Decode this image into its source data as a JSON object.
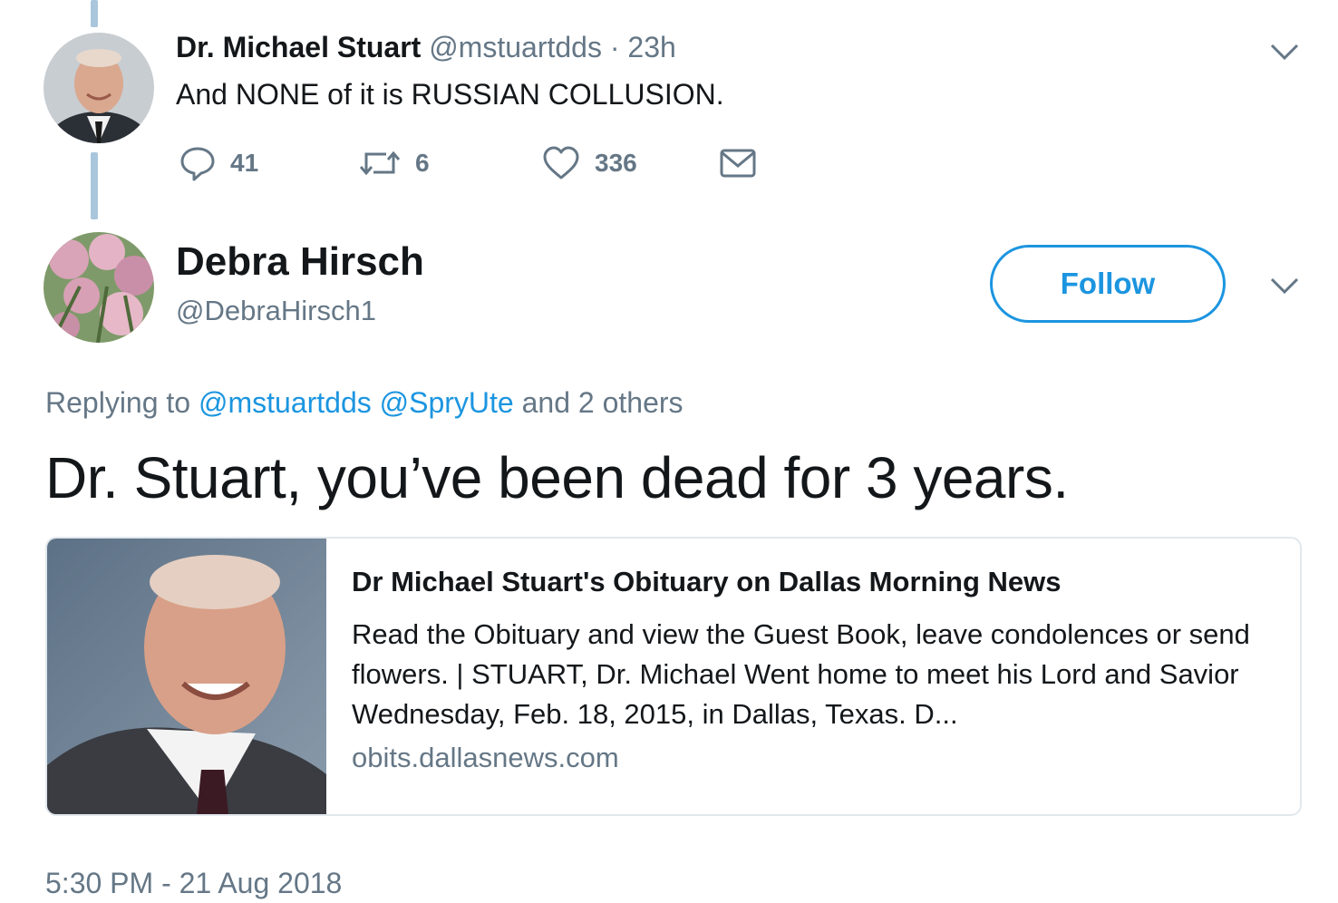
{
  "tweet1": {
    "display_name": "Dr. Michael Stuart",
    "handle": "@mstuartdds",
    "separator": "·",
    "time": "23h",
    "text": "And NONE of it is RUSSIAN COLLUSION.",
    "reply_count": "41",
    "retweet_count": "6",
    "like_count": "336"
  },
  "tweet2": {
    "display_name": "Debra Hirsch",
    "handle": "@DebraHirsch1",
    "follow_label": "Follow",
    "replying_prefix": "Replying to",
    "reply_mentions": [
      "@mstuartdds",
      "@SpryUte"
    ],
    "replying_suffix": "and 2 others",
    "text": "Dr. Stuart, you’ve been dead for 3 years.",
    "timestamp": "5:30 PM - 21 Aug 2018"
  },
  "card": {
    "title": "Dr Michael Stuart's Obituary on Dallas Morning News",
    "description": "Read the Obituary and view the Guest Book, leave condolences or send flowers. | STUART, Dr. Michael Went home to meet his Lord and Savior Wednesday, Feb. 18, 2015, in Dallas, Texas. D...",
    "domain": "obits.dallasnews.com"
  },
  "colors": {
    "accent": "#1c95e0",
    "secondary_text": "#657786",
    "primary_text": "#14171a",
    "thread_line": "#a9c6dc",
    "card_border": "#e1e8ed"
  },
  "icons": {
    "reply": "reply-icon",
    "retweet": "retweet-icon",
    "like": "heart-icon",
    "dm": "envelope-icon",
    "menu": "chevron-down-icon"
  }
}
